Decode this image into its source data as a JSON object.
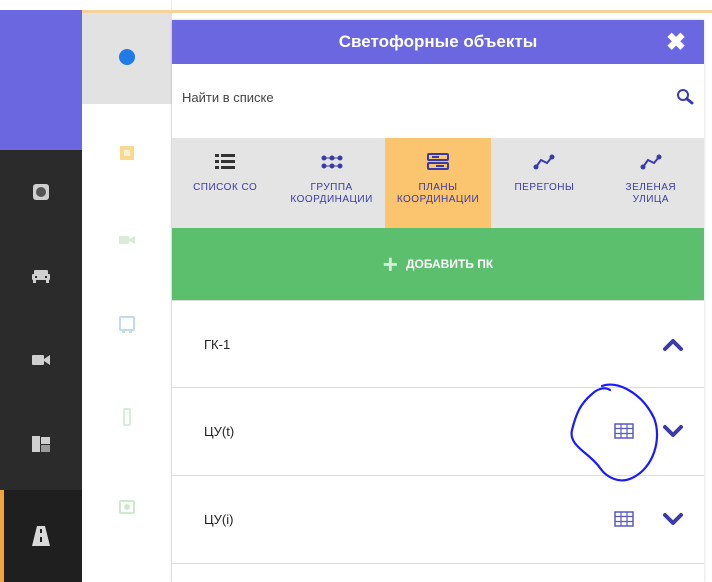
{
  "sidebar": {
    "items": [
      {
        "icon": "record-icon"
      },
      {
        "icon": "car-icon"
      },
      {
        "icon": "camera-icon"
      },
      {
        "icon": "traffic-sign-icon"
      },
      {
        "icon": "road-icon"
      }
    ]
  },
  "layers": [
    {
      "icon": "dot-icon",
      "color": "#1e7be8"
    },
    {
      "icon": "square-icon",
      "color": "#f7d98f"
    },
    {
      "icon": "video-icon",
      "color": "#d9ecd9"
    },
    {
      "icon": "bus-icon",
      "color": "#bfdcf2"
    },
    {
      "icon": "traffic-light-icon",
      "color": "#d9ecd9"
    },
    {
      "icon": "photo-icon",
      "color": "#cfe8cf"
    }
  ],
  "panel": {
    "title": "Светофорные объекты",
    "close_label": "✖",
    "search": {
      "placeholder": "Найти в списке"
    },
    "tabs": [
      {
        "label": "СПИСОК СО",
        "icon": "list-icon",
        "active": false
      },
      {
        "label": "ГРУППА\nКООРДИНАЦИИ",
        "icon": "group-icon",
        "active": false
      },
      {
        "label": "ПЛАНЫ\nКООРДИНАЦИИ",
        "icon": "plans-icon",
        "active": true
      },
      {
        "label": "ПЕРЕГОНЫ",
        "icon": "route-icon",
        "active": false
      },
      {
        "label": "ЗЕЛЕНАЯ\nУЛИЦА",
        "icon": "green-wave-icon",
        "active": false
      }
    ],
    "add_button": {
      "plus": "+",
      "label": "ДОБАВИТЬ ПК"
    },
    "rows": [
      {
        "label": "ГК-1",
        "expanded": true
      },
      {
        "label": "ЦУ(t)",
        "expanded": false
      },
      {
        "label": "ЦУ(i)",
        "expanded": false
      }
    ]
  },
  "colors": {
    "accent": "#6a67e0",
    "active_tab": "#fbc46e",
    "add_button": "#5bbf6e",
    "chevron": "#3a3aa8",
    "annotation": "#1a1aff"
  }
}
